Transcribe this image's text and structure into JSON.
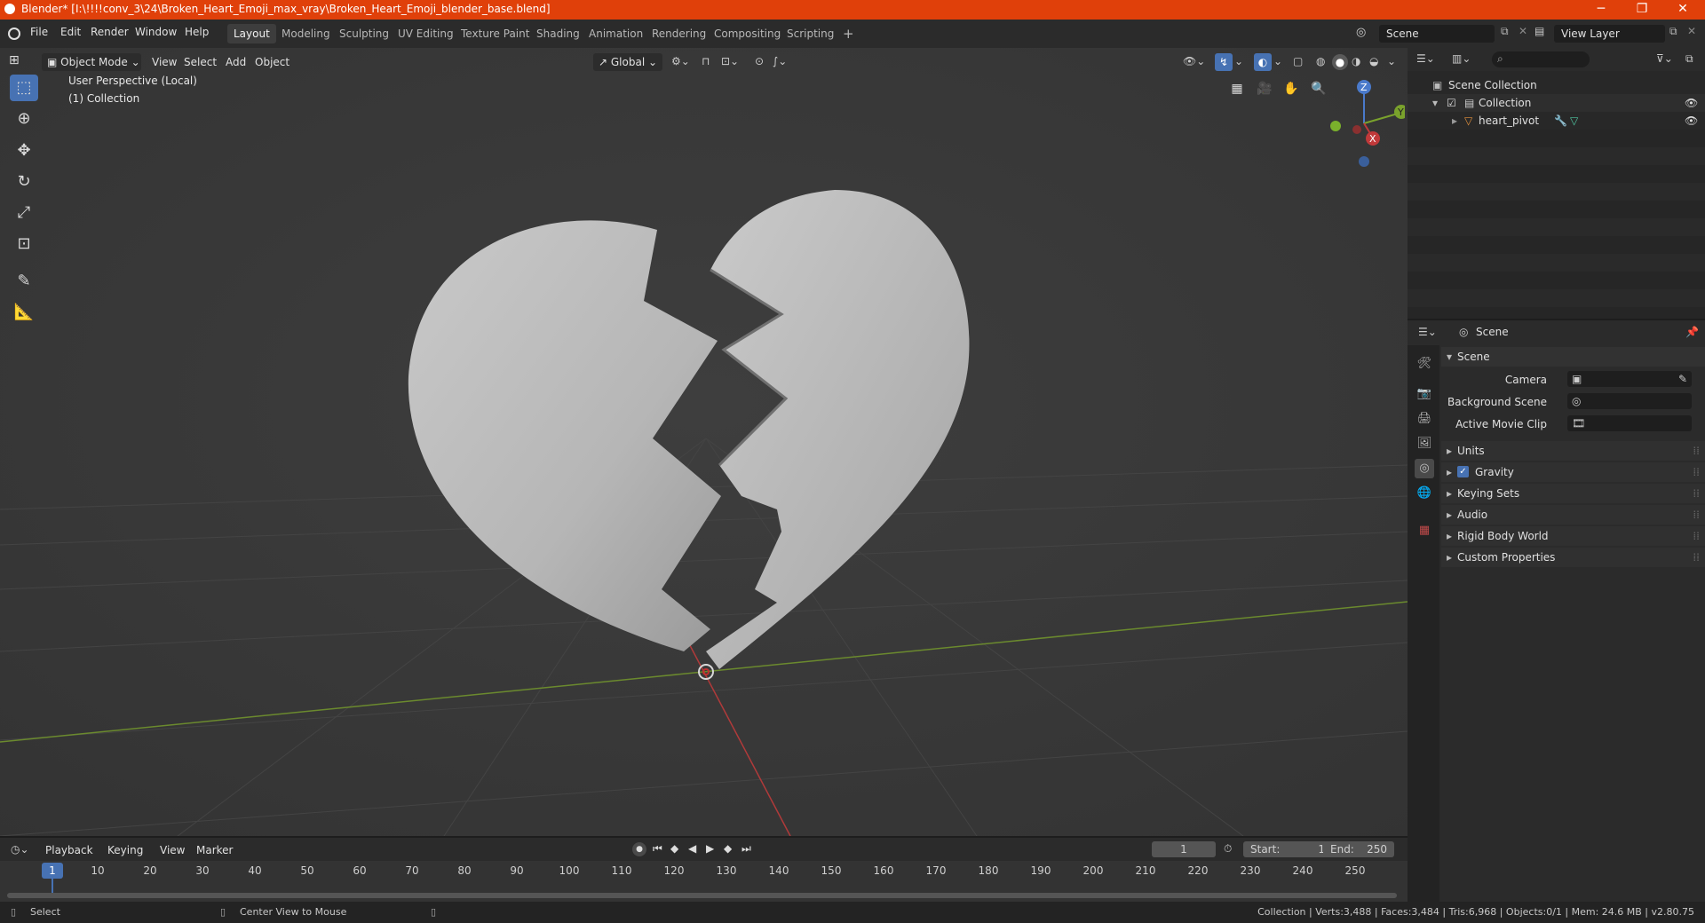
{
  "window": {
    "title": "Blender* [I:\\!!!!conv_3\\24\\Broken_Heart_Emoji_max_vray\\Broken_Heart_Emoji_blender_base.blend]",
    "minimize": "─",
    "maximize": "❐",
    "close": "✕"
  },
  "menubar": {
    "items": [
      "File",
      "Edit",
      "Render",
      "Window",
      "Help"
    ]
  },
  "workspaces": [
    "Layout",
    "Modeling",
    "Sculpting",
    "UV Editing",
    "Texture Paint",
    "Shading",
    "Animation",
    "Rendering",
    "Compositing",
    "Scripting"
  ],
  "add_workspace": "+",
  "scene_field": "Scene",
  "view_layer_field": "View Layer",
  "viewport": {
    "mode": "Object Mode",
    "menus": [
      "View",
      "Select",
      "Add",
      "Object"
    ],
    "transform_orientation": "Global",
    "overlay_line1": "User Perspective (Local)",
    "overlay_line2": "(1) Collection",
    "gizmo": {
      "z": "Z",
      "x": "X",
      "y": "Y"
    }
  },
  "outliner": {
    "root": "Scene Collection",
    "collection": "Collection",
    "object": "heart_pivot"
  },
  "properties": {
    "header": "Scene",
    "panel": "Scene",
    "camera_label": "Camera",
    "background_label": "Background Scene",
    "movieclip_label": "Active Movie Clip",
    "sections": [
      "Units",
      "Gravity",
      "Keying Sets",
      "Audio",
      "Rigid Body World",
      "Custom Properties"
    ],
    "gravity_checked": true
  },
  "timeline": {
    "menus": [
      "Playback",
      "Keying",
      "View",
      "Marker"
    ],
    "current_frame": "1",
    "start_label": "Start:",
    "start": "1",
    "end_label": "End:",
    "end": "250",
    "ticks": [
      "1",
      "10",
      "20",
      "30",
      "40",
      "50",
      "60",
      "70",
      "80",
      "90",
      "100",
      "110",
      "120",
      "130",
      "140",
      "150",
      "160",
      "170",
      "180",
      "190",
      "200",
      "210",
      "220",
      "230",
      "240",
      "250"
    ]
  },
  "statusbar": {
    "select": "Select",
    "center_view": "Center View to Mouse",
    "stats": "Collection | Verts:3,488 | Faces:3,484 | Tris:6,968 | Objects:0/1 | Mem: 24.6 MB | v2.80.75"
  }
}
